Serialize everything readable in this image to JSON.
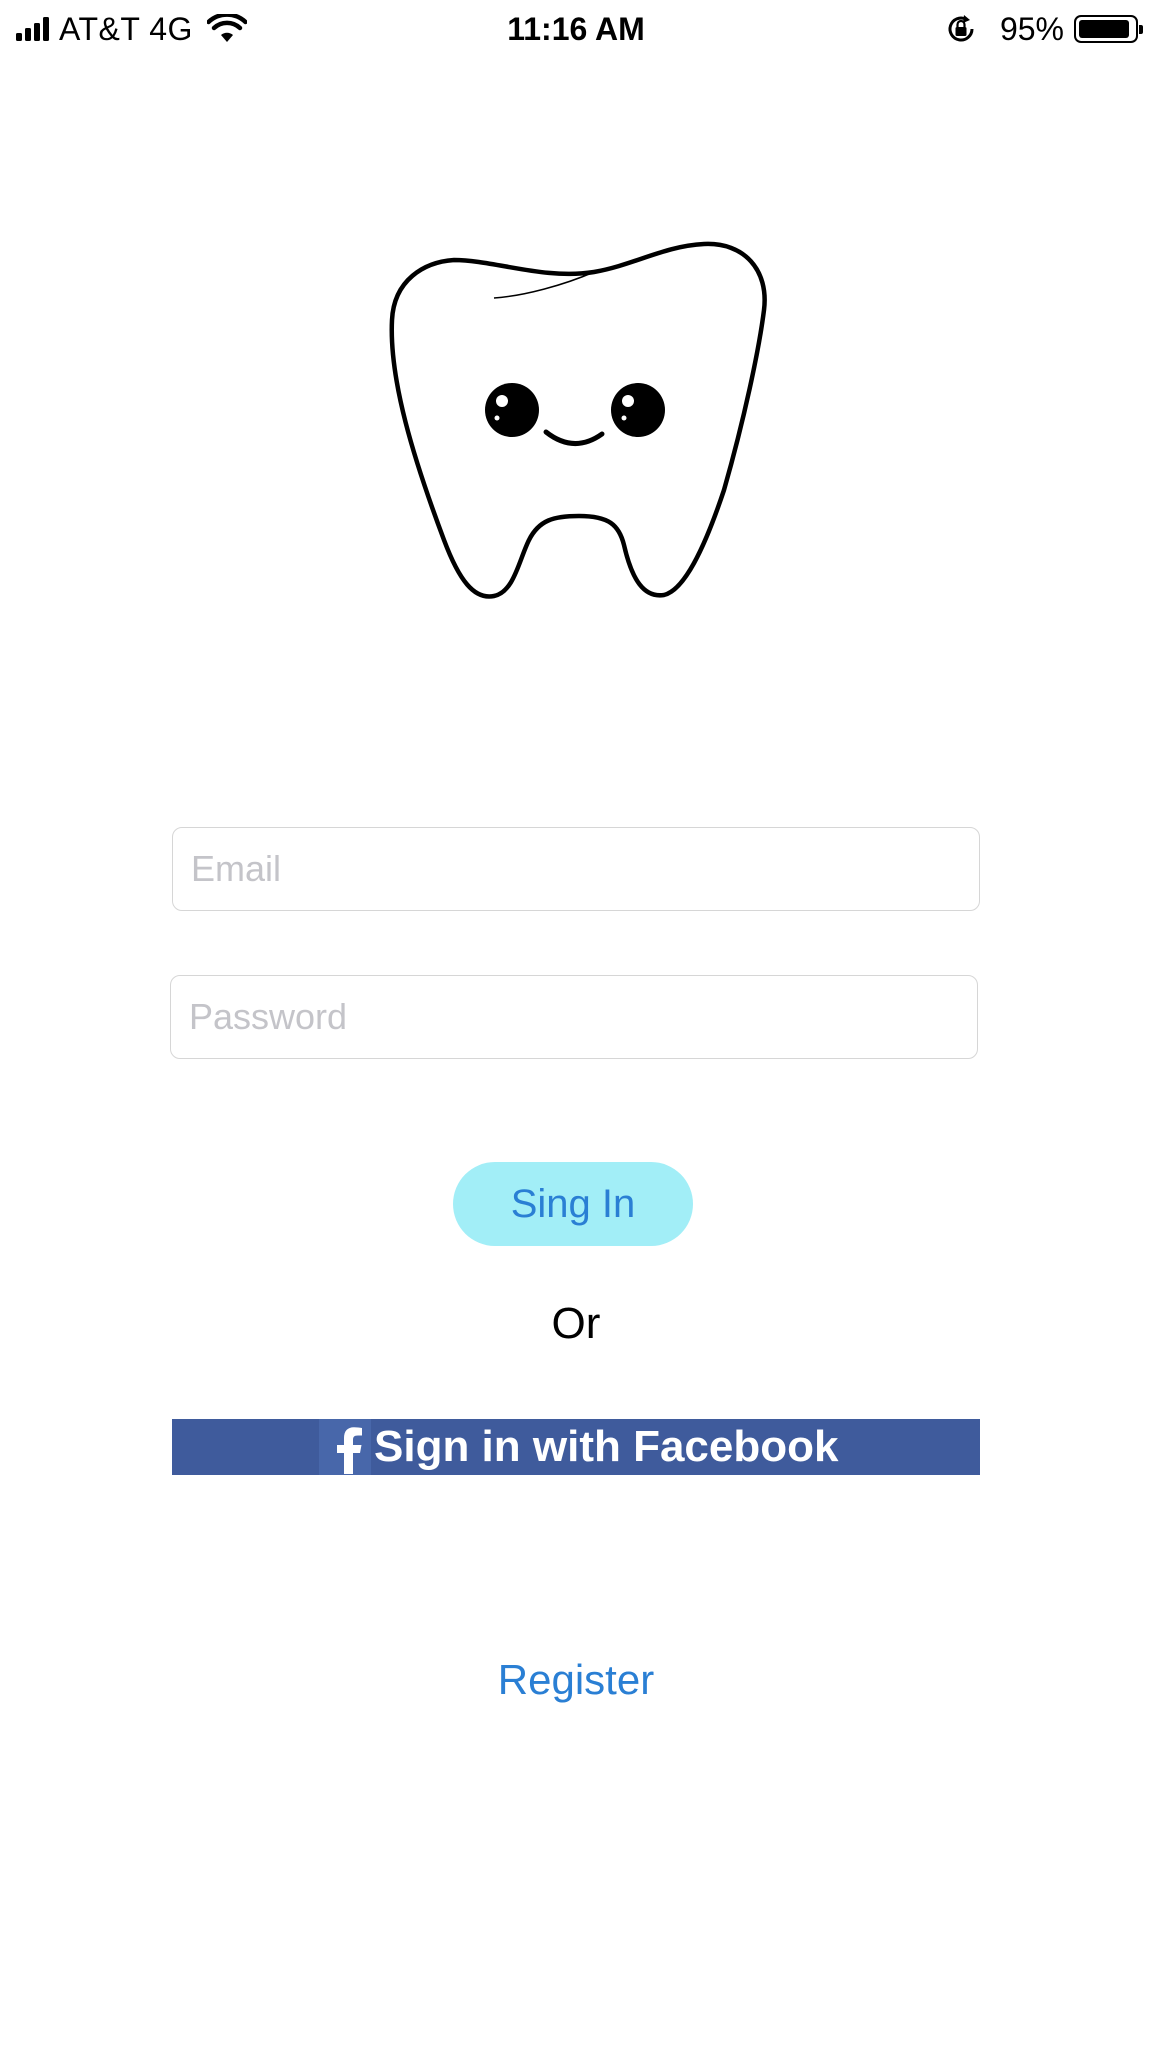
{
  "status_bar": {
    "carrier": "AT&T 4G",
    "time": "11:16 AM",
    "battery_percent": "95%",
    "battery_level": 0.95,
    "icons": [
      "signal-icon",
      "wifi-icon",
      "rotation-lock-icon",
      "battery-icon"
    ]
  },
  "logo": {
    "icon": "tooth-logo-icon"
  },
  "login_form": {
    "email_placeholder": "Email",
    "email_value": "",
    "password_placeholder": "Password",
    "password_value": "",
    "signin_label": "Sing In",
    "or_label": "Or",
    "facebook_label": "Sign in with Facebook",
    "facebook_icon": "facebook-icon",
    "register_label": "Register"
  },
  "colors": {
    "accent": "#2a7fd4",
    "signin_background": "#a2eef7",
    "facebook_blue": "#3f5b9c"
  }
}
